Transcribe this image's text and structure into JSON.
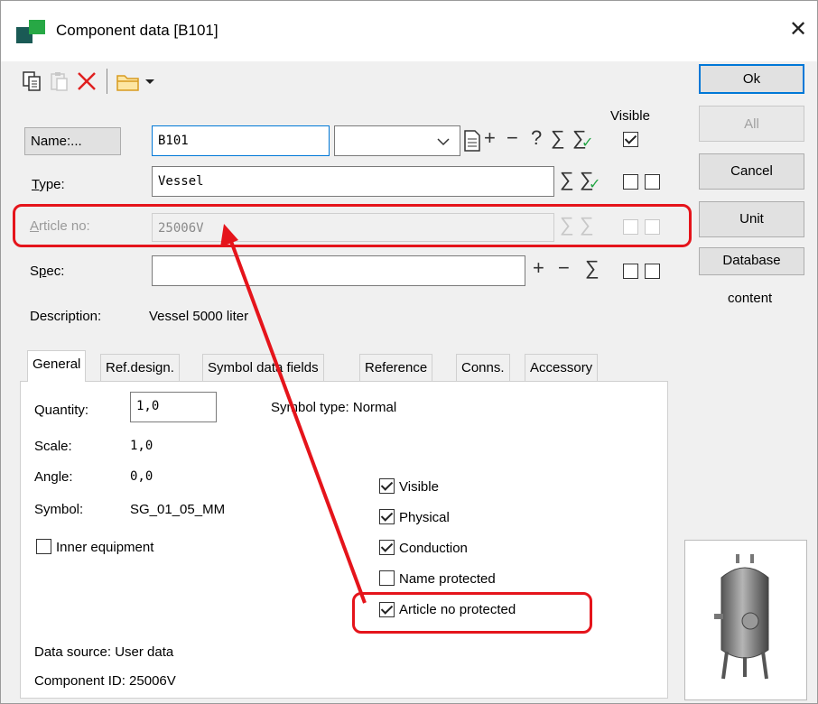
{
  "window": {
    "title": "Component data [B101]"
  },
  "header": {
    "visible_label": "Visible"
  },
  "fields": {
    "name": {
      "button_label": "Name:...",
      "value": "B101"
    },
    "type": {
      "label": "Type:",
      "underline_char": "T",
      "rest": "ype:",
      "value": "Vessel"
    },
    "article": {
      "label": "Article no:",
      "underline_char": "A",
      "rest": "rticle no:",
      "value": "25006V"
    },
    "spec": {
      "label": "Spec:",
      "underline_char": "p",
      "pre": "S",
      "rest": "ec:",
      "value": ""
    },
    "description": {
      "label": "Description:",
      "value": "Vessel 5000 liter"
    }
  },
  "right_buttons": {
    "ok": "Ok",
    "all": "All",
    "cancel": "Cancel",
    "unit": "Unit",
    "database": "Database",
    "content": "content"
  },
  "tabs": [
    "General",
    "Ref.design.",
    "Symbol data fields",
    "Reference",
    "Conns.",
    "Accessory"
  ],
  "general": {
    "quantity_label": "Quantity:",
    "quantity_value": "1,0",
    "symbol_type": "Symbol type: Normal",
    "scale_label": "Scale:",
    "scale_value": "1,0",
    "angle_label": "Angle:",
    "angle_value": "0,0",
    "symbol_label": "Symbol:",
    "symbol_value": "SG_01_05_MM",
    "inner_equipment": "Inner equipment",
    "checkboxes": [
      {
        "label": "Visible",
        "checked": true
      },
      {
        "label": "Physical",
        "checked": true
      },
      {
        "label": "Conduction",
        "checked": true
      },
      {
        "label": "Name protected",
        "checked": false
      },
      {
        "label": "Article no protected",
        "checked": true
      }
    ],
    "data_source": "Data source: User data",
    "component_id": "Component ID: 25006V"
  },
  "colors": {
    "annotation_red": "#e5141b",
    "focus_blue": "#0078d7"
  }
}
